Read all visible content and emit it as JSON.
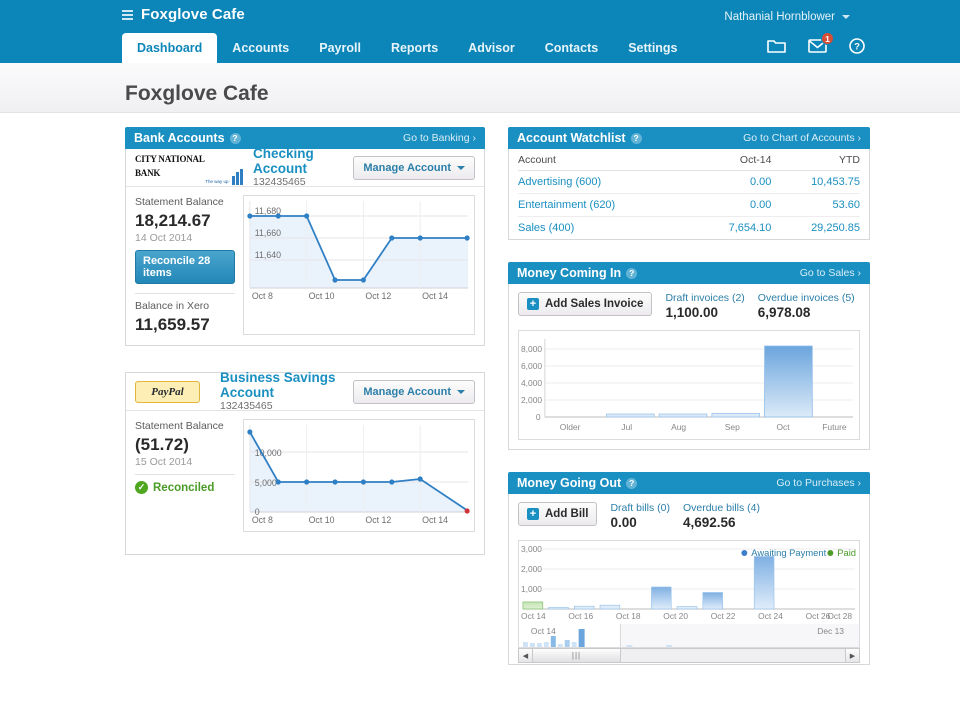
{
  "header": {
    "brand": "Foxglove Cafe",
    "menu_icon": "hamburger-icon",
    "user": "Nathanial Hornblower",
    "nav": [
      {
        "label": "Dashboard",
        "active": true
      },
      {
        "label": "Accounts",
        "active": false
      },
      {
        "label": "Payroll",
        "active": false
      },
      {
        "label": "Reports",
        "active": false
      },
      {
        "label": "Advisor",
        "active": false
      },
      {
        "label": "Contacts",
        "active": false
      },
      {
        "label": "Settings",
        "active": false
      }
    ],
    "icons": [
      {
        "name": "folder-icon"
      },
      {
        "name": "envelope-icon",
        "badge": "1"
      },
      {
        "name": "help-icon"
      }
    ]
  },
  "page_title": "Foxglove Cafe",
  "panels": {
    "bank_accounts": {
      "title": "Bank Accounts",
      "help": "?",
      "link": "Go to Banking ›",
      "accounts": [
        {
          "logo": "city-national-bank-logo",
          "logo_text": "CITY NATIONAL BANK",
          "logo_tagline": "The way up·",
          "name": "Checking Account",
          "number": "132435465",
          "manage_label": "Manage Account",
          "statement_label": "Statement Balance",
          "statement_amount": "18,214.67",
          "statement_date": "14 Oct 2014",
          "action_label": "Reconcile 28 items",
          "balance_label": "Balance in Xero",
          "balance_amount": "11,659.57"
        },
        {
          "logo": "paypal-logo",
          "logo_text": "PayPal",
          "name": "Business Savings Account",
          "number": "132435465",
          "manage_label": "Manage Account",
          "statement_label": "Statement Balance",
          "statement_amount": "(51.72)",
          "statement_date": "15 Oct 2014",
          "action_label": "Reconciled",
          "balance_label": "",
          "balance_amount": ""
        }
      ]
    },
    "account_watchlist": {
      "title": "Account Watchlist",
      "help": "?",
      "link": "Go to Chart of Accounts ›",
      "columns": [
        "Account",
        "Oct-14",
        "YTD"
      ],
      "rows": [
        {
          "account": "Advertising (600)",
          "period": "0.00",
          "ytd": "10,453.75"
        },
        {
          "account": "Entertainment (620)",
          "period": "0.00",
          "ytd": "53.60"
        },
        {
          "account": "Sales (400)",
          "period": "7,654.10",
          "ytd": "29,250.85"
        }
      ]
    },
    "money_coming_in": {
      "title": "Money Coming In",
      "help": "?",
      "link": "Go to Sales ›",
      "add_label": "Add Sales Invoice",
      "stats": [
        {
          "label": "Draft invoices (2)",
          "value": "1,100.00"
        },
        {
          "label": "Overdue invoices (5)",
          "value": "6,978.08"
        }
      ]
    },
    "money_going_out": {
      "title": "Money Going Out",
      "help": "?",
      "link": "Go to Purchases ›",
      "add_label": "Add Bill",
      "stats": [
        {
          "label": "Draft bills (0)",
          "value": "0.00"
        },
        {
          "label": "Overdue bills (4)",
          "value": "4,692.56"
        }
      ],
      "legend": [
        {
          "label": "Awaiting Payment",
          "color": "#3d7fc9"
        },
        {
          "label": "Paid",
          "color": "#4f9b2a"
        }
      ],
      "mini_start": "Oct 14",
      "mini_end": "Dec 13"
    }
  },
  "chart_data": [
    {
      "type": "line",
      "title": "Checking Account balance",
      "x": [
        "Oct 8",
        "Oct 9",
        "Oct 10",
        "Oct 11",
        "Oct 12",
        "Oct 13",
        "Oct 14",
        "Oct 15"
      ],
      "values": [
        11674,
        11674,
        11674,
        11631,
        11631,
        11659.57,
        11659.57,
        11659.57
      ],
      "xticks": [
        "Oct 8",
        "Oct 10",
        "Oct 12",
        "Oct 14"
      ],
      "yticks": [
        11640,
        11660,
        11680
      ],
      "ylim": [
        11622,
        11690
      ],
      "xlabel": "",
      "ylabel": "",
      "grid": true,
      "line_color": "#2f7fc4",
      "fill_color": "#eaf3fb"
    },
    {
      "type": "line",
      "title": "Business Savings Account balance",
      "x": [
        "Oct 8",
        "Oct 9",
        "Oct 10",
        "Oct 11",
        "Oct 12",
        "Oct 13",
        "Oct 14",
        "Oct 15"
      ],
      "values": [
        12000,
        4650,
        4650,
        4650,
        4650,
        4650,
        4800,
        -51.72
      ],
      "xticks": [
        "Oct 8",
        "Oct 10",
        "Oct 12",
        "Oct 14"
      ],
      "yticks": [
        0,
        5000,
        10000
      ],
      "ylim": [
        -600,
        13000
      ],
      "xlabel": "",
      "ylabel": "",
      "grid": true,
      "line_color": "#2f7fc4",
      "fill_color": "#eaf3fb",
      "end_marker_color": "#d0343a"
    },
    {
      "type": "bar",
      "title": "Money Coming In",
      "categories": [
        "Older",
        "Jul",
        "Aug",
        "Sep",
        "Oct",
        "Future"
      ],
      "values": [
        0,
        170,
        170,
        190,
        8400,
        0
      ],
      "yticks": [
        0,
        2000,
        4000,
        6000,
        8000
      ],
      "ylim": [
        0,
        9200
      ],
      "xlabel": "",
      "ylabel": "",
      "grid": true,
      "bar_color": "#a9cdef"
    },
    {
      "type": "bar",
      "title": "Money Going Out",
      "categories": [
        "Oct 14",
        "Oct 15",
        "Oct 16",
        "Oct 17",
        "Oct 18",
        "Oct 19",
        "Oct 20",
        "Oct 21",
        "Oct 22",
        "Oct 23",
        "Oct 24",
        "Oct 25",
        "Oct 26",
        "Oct 27",
        "Oct 28"
      ],
      "series": [
        {
          "name": "Paid",
          "color": "#4f9b2a",
          "values": [
            330,
            0,
            0,
            0,
            0,
            0,
            0,
            0,
            0,
            0,
            0,
            0,
            0,
            0,
            0
          ]
        },
        {
          "name": "Awaiting Payment",
          "color": "#3d7fc9",
          "values": [
            0,
            60,
            130,
            180,
            0,
            1100,
            110,
            820,
            0,
            2620,
            0,
            0,
            0,
            0,
            0
          ]
        }
      ],
      "yticks": [
        0,
        1000,
        2000,
        3000
      ],
      "ylim": [
        0,
        3100
      ],
      "xticks": [
        "Oct 14",
        "Oct 16",
        "Oct 18",
        "Oct 20",
        "Oct 22",
        "Oct 24",
        "Oct 26",
        "Oct 28"
      ],
      "xlabel": "",
      "ylabel": "",
      "grid": true,
      "legend_position": "top-right"
    }
  ]
}
